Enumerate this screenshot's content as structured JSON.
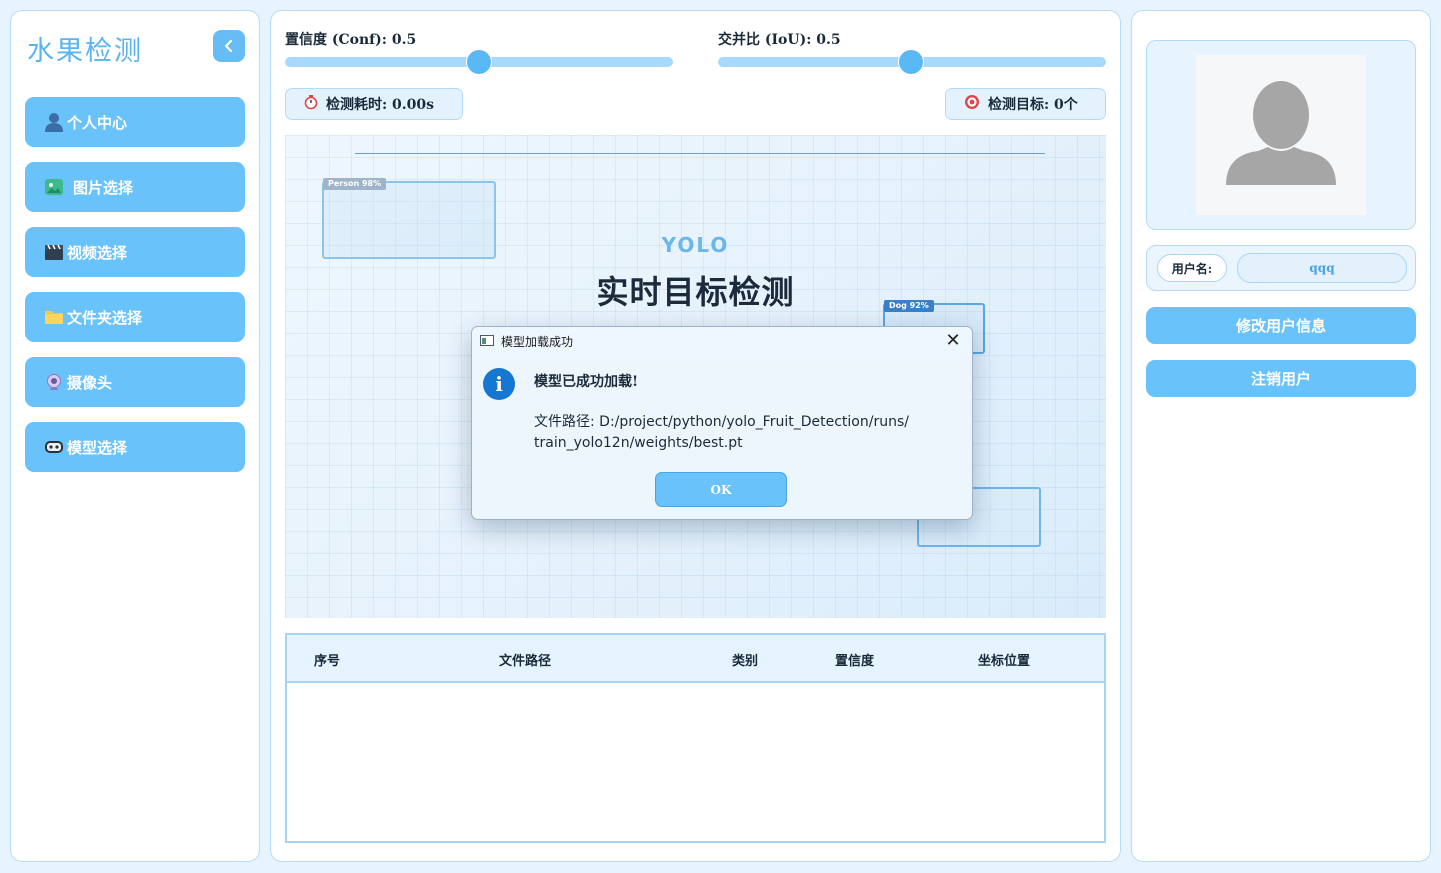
{
  "sidebar": {
    "title": "水果检测",
    "items": [
      {
        "label": "个人中心",
        "icon": "person-icon"
      },
      {
        "label": "图片选择",
        "icon": "image-icon"
      },
      {
        "label": "视频选择",
        "icon": "clapperboard-icon"
      },
      {
        "label": "文件夹选择",
        "icon": "folder-icon"
      },
      {
        "label": "摄像头",
        "icon": "webcam-icon"
      },
      {
        "label": "模型选择",
        "icon": "robot-icon"
      }
    ]
  },
  "controls": {
    "conf": {
      "label": "置信度 (Conf): 0.5",
      "value": 0.5
    },
    "iou": {
      "label": "交并比 (IoU): 0.5",
      "value": 0.5
    },
    "time_label": "检测耗时: 0.00s",
    "targets_label": "检测目标: 0个"
  },
  "preview": {
    "subtitle": "YOLO",
    "title": "实时目标检测",
    "tags": {
      "person": "Person 98%",
      "dog": "Dog 92%"
    }
  },
  "table": {
    "headers": [
      "序号",
      "文件路径",
      "类别",
      "置信度",
      "坐标位置"
    ],
    "rows": []
  },
  "user": {
    "name_label": "用户名:",
    "name_value": "qqq",
    "edit_label": "修改用户信息",
    "logout_label": "注销用户"
  },
  "dialog": {
    "title": "模型加载成功",
    "message": "模型已成功加载!",
    "path_line1": "文件路径: D:/project/python/yolo_Fruit_Detection/runs/",
    "path_line2": "train_yolo12n/weights/best.pt",
    "ok_label": "OK",
    "close": "✕",
    "info": "i"
  },
  "colors": {
    "accent": "#6ac2fa",
    "title": "#5ab4f0",
    "info_icon": "#1677d2",
    "background": "#e8f4fd"
  }
}
